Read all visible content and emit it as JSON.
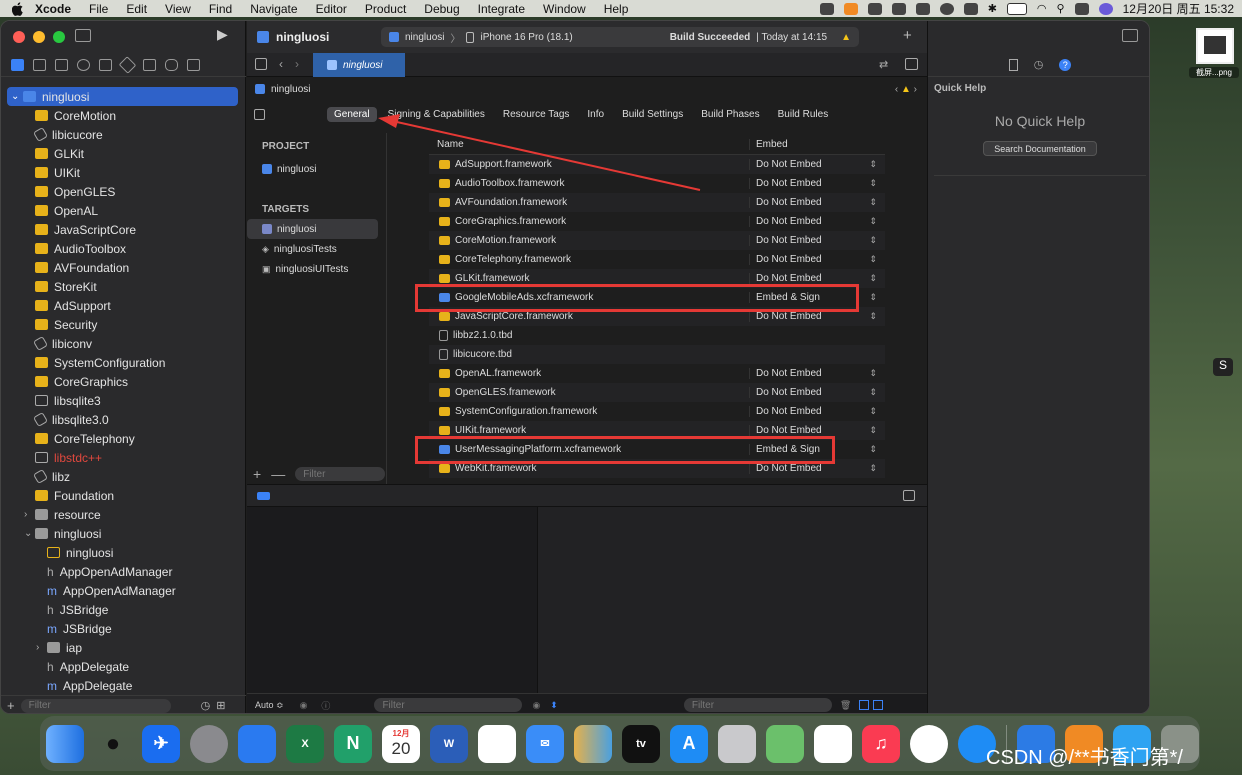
{
  "menubar": {
    "app": "Xcode",
    "items": [
      "File",
      "Edit",
      "View",
      "Find",
      "Navigate",
      "Editor",
      "Product",
      "Debug",
      "Integrate",
      "Window",
      "Help"
    ],
    "datetime": "12月20日 周五  15:32"
  },
  "toolbar": {
    "project_name": "ningluosi",
    "scheme": "ningluosi",
    "device": "iPhone 16 Pro (18.1)",
    "build_status": "Build Succeeded",
    "build_time": "| Today at 14:15"
  },
  "navigator": {
    "items": [
      {
        "label": "ningluosi",
        "type": "proj"
      },
      {
        "label": "CoreMotion",
        "type": "fw"
      },
      {
        "label": "libicucore",
        "type": "lib"
      },
      {
        "label": "GLKit",
        "type": "fw"
      },
      {
        "label": "UIKit",
        "type": "fw"
      },
      {
        "label": "OpenGLES",
        "type": "fw"
      },
      {
        "label": "OpenAL",
        "type": "fw"
      },
      {
        "label": "JavaScriptCore",
        "type": "fw"
      },
      {
        "label": "AudioToolbox",
        "type": "fw"
      },
      {
        "label": "AVFoundation",
        "type": "fw"
      },
      {
        "label": "StoreKit",
        "type": "fw"
      },
      {
        "label": "AdSupport",
        "type": "fw"
      },
      {
        "label": "Security",
        "type": "fw"
      },
      {
        "label": "libiconv",
        "type": "lib"
      },
      {
        "label": "SystemConfiguration",
        "type": "fw"
      },
      {
        "label": "CoreGraphics",
        "type": "fw"
      },
      {
        "label": "libsqlite3",
        "type": "lib"
      },
      {
        "label": "libsqlite3.0",
        "type": "lib"
      },
      {
        "label": "CoreTelephony",
        "type": "fw"
      },
      {
        "label": "libstdc++",
        "type": "red"
      },
      {
        "label": "libz",
        "type": "lib"
      },
      {
        "label": "Foundation",
        "type": "fw"
      },
      {
        "label": "resource",
        "type": "folder"
      },
      {
        "label": "ningluosi",
        "type": "folder"
      },
      {
        "label": "ningluosi",
        "type": "proj"
      },
      {
        "label": "AppOpenAdManager",
        "type": "h"
      },
      {
        "label": "AppOpenAdManager",
        "type": "m"
      },
      {
        "label": "JSBridge",
        "type": "h"
      },
      {
        "label": "JSBridge",
        "type": "m"
      },
      {
        "label": "iap",
        "type": "folder"
      },
      {
        "label": "AppDelegate",
        "type": "h"
      },
      {
        "label": "AppDelegate",
        "type": "m"
      }
    ],
    "filter_placeholder": "Filter"
  },
  "editor": {
    "file_tab": "ningluosi",
    "jump_bar": "ningluosi",
    "tabs": [
      "General",
      "Signing & Capabilities",
      "Resource Tags",
      "Info",
      "Build Settings",
      "Build Phases",
      "Build Rules"
    ],
    "project_header": "PROJECT",
    "project_item": "ningluosi",
    "targets_header": "TARGETS",
    "targets": [
      "ningluosi",
      "ningluosiTests",
      "ningluosiUITests"
    ],
    "filter_placeholder": "Filter",
    "table": {
      "col_name": "Name",
      "col_embed": "Embed",
      "rows": [
        {
          "name": "AdSupport.framework",
          "embed": "Do Not Embed",
          "icon": "fw"
        },
        {
          "name": "AudioToolbox.framework",
          "embed": "Do Not Embed",
          "icon": "fw"
        },
        {
          "name": "AVFoundation.framework",
          "embed": "Do Not Embed",
          "icon": "fw"
        },
        {
          "name": "CoreGraphics.framework",
          "embed": "Do Not Embed",
          "icon": "fw"
        },
        {
          "name": "CoreMotion.framework",
          "embed": "Do Not Embed",
          "icon": "fw"
        },
        {
          "name": "CoreTelephony.framework",
          "embed": "Do Not Embed",
          "icon": "fw"
        },
        {
          "name": "GLKit.framework",
          "embed": "Do Not Embed",
          "icon": "fw"
        },
        {
          "name": "GoogleMobileAds.xcframework",
          "embed": "Embed & Sign",
          "icon": "xc"
        },
        {
          "name": "JavaScriptCore.framework",
          "embed": "Do Not Embed",
          "icon": "fw"
        },
        {
          "name": "libbz2.1.0.tbd",
          "embed": "",
          "icon": "tbd"
        },
        {
          "name": "libicucore.tbd",
          "embed": "",
          "icon": "tbd"
        },
        {
          "name": "OpenAL.framework",
          "embed": "Do Not Embed",
          "icon": "fw"
        },
        {
          "name": "OpenGLES.framework",
          "embed": "Do Not Embed",
          "icon": "fw"
        },
        {
          "name": "SystemConfiguration.framework",
          "embed": "Do Not Embed",
          "icon": "fw"
        },
        {
          "name": "UIKit.framework",
          "embed": "Do Not Embed",
          "icon": "fw"
        },
        {
          "name": "UserMessagingPlatform.xcframework",
          "embed": "Embed & Sign",
          "icon": "xc"
        },
        {
          "name": "WebKit.framework",
          "embed": "Do Not Embed",
          "icon": "fw"
        }
      ]
    }
  },
  "debug": {
    "auto_label": "Auto ≎",
    "filter_placeholder": "Filter"
  },
  "inspector": {
    "title": "Quick Help",
    "empty": "No Quick Help",
    "search_button": "Search Documentation"
  },
  "desktop": {
    "file_label": "截屏...png",
    "watermark": "CSDN @/**书香门第*/"
  },
  "dock": {
    "calendar_month": "12月",
    "calendar_day": "20",
    "tv_label": "tv",
    "icons": [
      "finder",
      "qq",
      "feishu",
      "system-settings",
      "lark",
      "excel",
      "nodepad",
      "calendar",
      "word",
      "reminders",
      "mail",
      "books",
      "appletv",
      "appstore",
      "launchpad",
      "maps",
      "freeform",
      "music",
      "chrome",
      "safari",
      "xcode",
      "hb",
      "qq-browser",
      "trash"
    ]
  },
  "colors": {
    "accent": "#2f62c9",
    "highlight": "#e53935",
    "folder": "#e7b21a"
  }
}
